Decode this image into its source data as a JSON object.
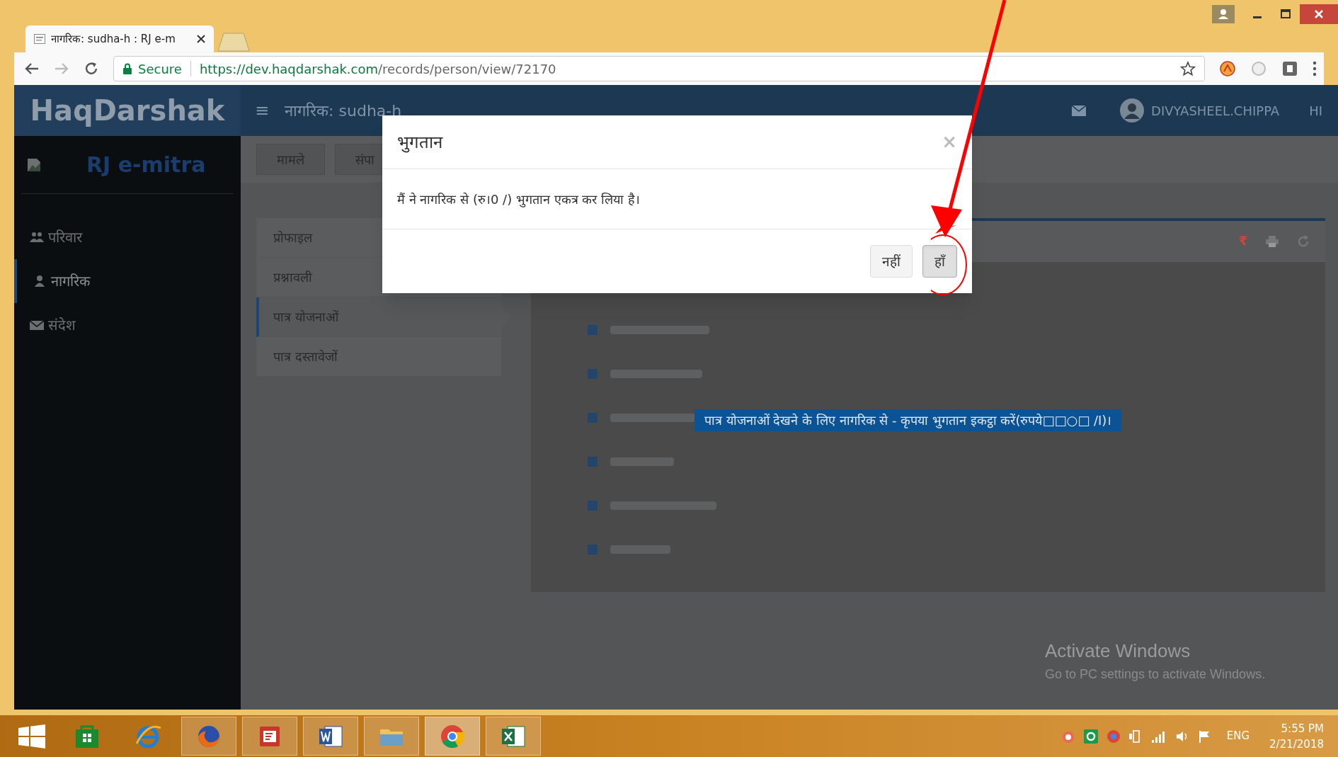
{
  "browser": {
    "tab": {
      "title": "नागरिक: sudha-h : RJ e-m",
      "selected": true
    },
    "secure_label": "Secure",
    "url_host": "https://dev.haqdarshak.com",
    "url_path": "/records/person/view/72170"
  },
  "header": {
    "brand": "HaqDarshak",
    "menu_glyph": "≡",
    "page_title": "नागरिक: sudha-h",
    "user": "DIVYASHEEL.CHIPPA",
    "language": "HI"
  },
  "sidebar": {
    "org": "RJ e-mitra",
    "items": [
      {
        "label": "परिवार",
        "selected": false
      },
      {
        "label": "नागरिक",
        "selected": true
      },
      {
        "label": "संदेश",
        "selected": false
      }
    ]
  },
  "top_tabs": [
    {
      "label": "मामले"
    },
    {
      "label": "संपा"
    }
  ],
  "sub_menu": [
    {
      "label": "प्रोफाइल",
      "selected": false
    },
    {
      "label": "प्रश्नावली",
      "selected": false
    },
    {
      "label": "पात्र योजनाओं",
      "selected": true
    },
    {
      "label": "पात्र दस्तावेजों",
      "selected": false
    }
  ],
  "panel": {
    "rupee_glyph": "₹",
    "notice": "पात्र योजनाओं देखने के लिए नागरिक से - कृपया भुगतान इकट्ठा करें(रुपये□□○□ /I)।"
  },
  "modal": {
    "title": "भुगतान",
    "close_glyph": "×",
    "message": "मैं ने नागरिक से (रु।0 /) भुगतान एकत्र कर लिया है।",
    "buttons": [
      {
        "label": "नहीं",
        "selected": false
      },
      {
        "label": "हाँ",
        "selected": true
      }
    ]
  },
  "windows_notice": {
    "title": "Activate Windows",
    "subtitle": "Go to PC settings to activate Windows."
  },
  "taskbar": {
    "apps": [
      {
        "running": false,
        "selected": false
      },
      {
        "running": false,
        "selected": false
      },
      {
        "running": true,
        "selected": false
      },
      {
        "running": true,
        "selected": false
      },
      {
        "running": true,
        "selected": false
      },
      {
        "running": true,
        "selected": false
      },
      {
        "running": true,
        "selected": true
      },
      {
        "running": true,
        "selected": false
      }
    ],
    "language": "ENG",
    "time": "5:55 PM",
    "date": "2/21/2018"
  }
}
